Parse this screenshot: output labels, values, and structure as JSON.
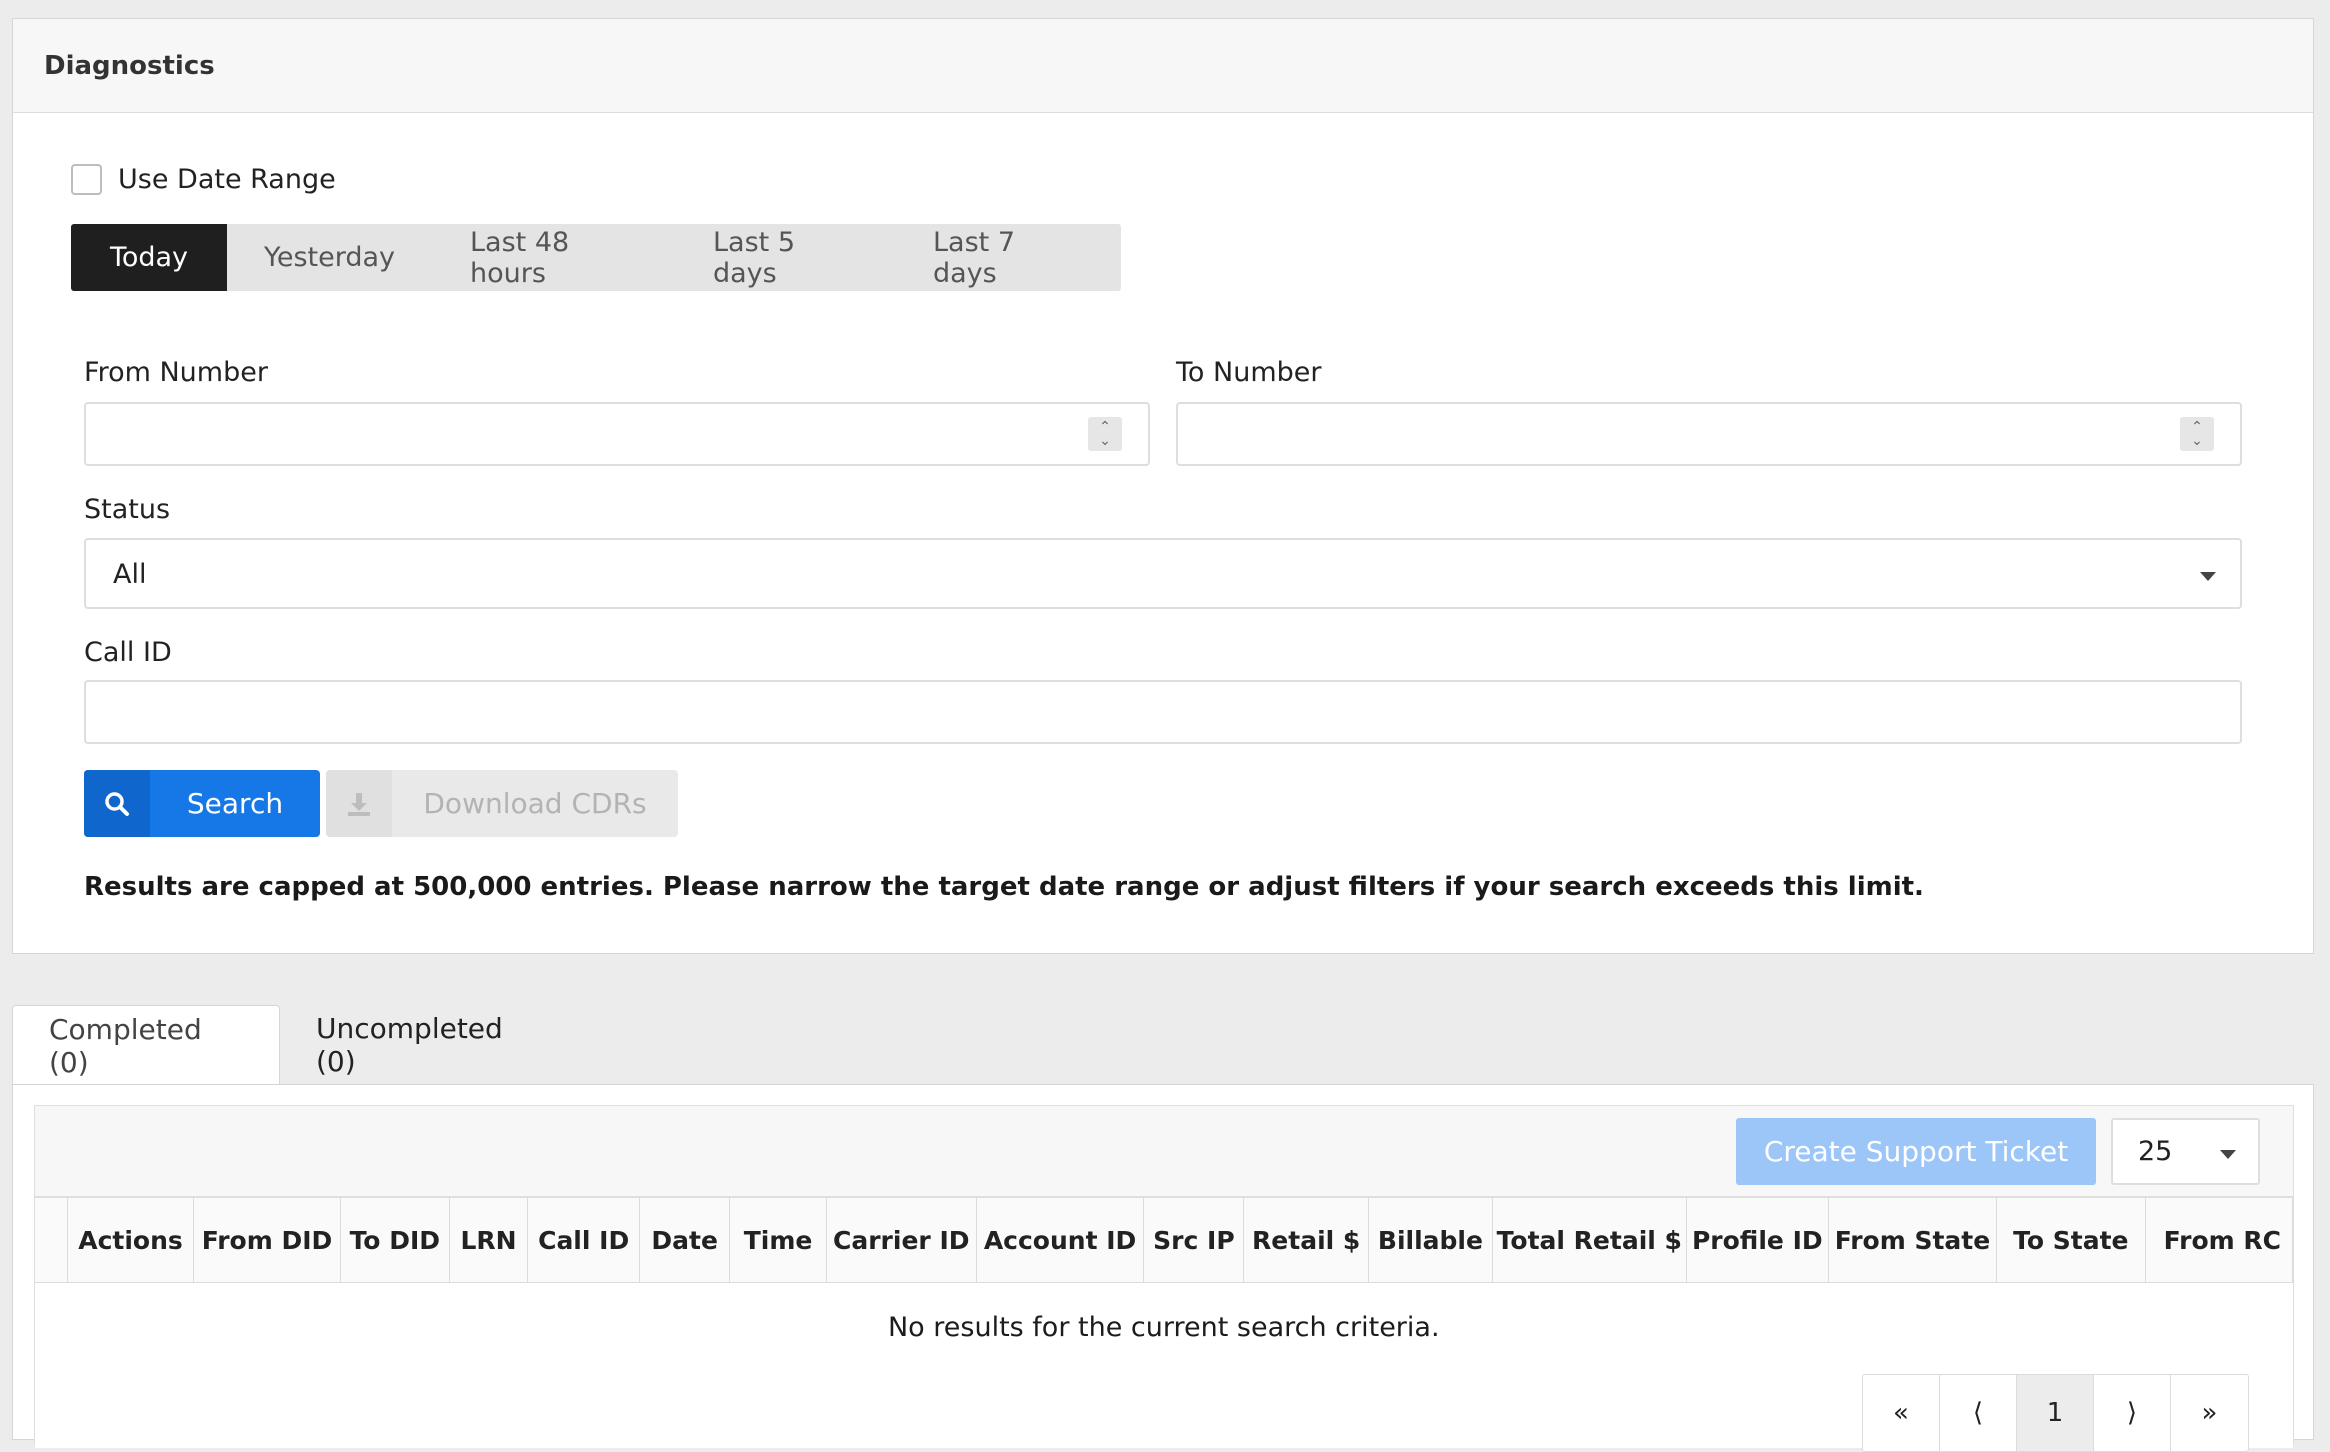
{
  "panel": {
    "title": "Diagnostics"
  },
  "date_range": {
    "use_label": "Use Date Range",
    "presets": [
      "Today",
      "Yesterday",
      "Last 48 hours",
      "Last 5 days",
      "Last 7 days"
    ],
    "active": "Today"
  },
  "filters": {
    "from_number": {
      "label": "From Number",
      "value": ""
    },
    "to_number": {
      "label": "To Number",
      "value": ""
    },
    "status": {
      "label": "Status",
      "value": "All"
    },
    "call_id": {
      "label": "Call ID",
      "value": ""
    }
  },
  "actions": {
    "search": "Search",
    "download": "Download CDRs"
  },
  "notice": "Results are capped at 500,000 entries. Please narrow the target date range or adjust filters if your search exceeds this limit.",
  "tabs": [
    {
      "label": "Completed (0)",
      "active": true
    },
    {
      "label": "Uncompleted (0)",
      "active": false
    }
  ],
  "results": {
    "create_ticket": "Create Support Ticket",
    "page_size": "25",
    "columns": [
      "Actions",
      "From DID",
      "To DID",
      "LRN",
      "Call ID",
      "Date",
      "Time",
      "Carrier ID",
      "Account ID",
      "Src IP",
      "Retail $",
      "Billable",
      "Total Retail $",
      "Profile ID",
      "From State",
      "To State",
      "From RC"
    ],
    "empty_message": "No results for the current search criteria.",
    "pager": {
      "first": "«",
      "prev": "⟨",
      "current": "1",
      "next": "⟩",
      "last": "»"
    }
  },
  "colors": {
    "primary": "#1677e6",
    "dark_toggle": "#1f1f1f",
    "ticket_disabled": "#9cc6f7"
  }
}
